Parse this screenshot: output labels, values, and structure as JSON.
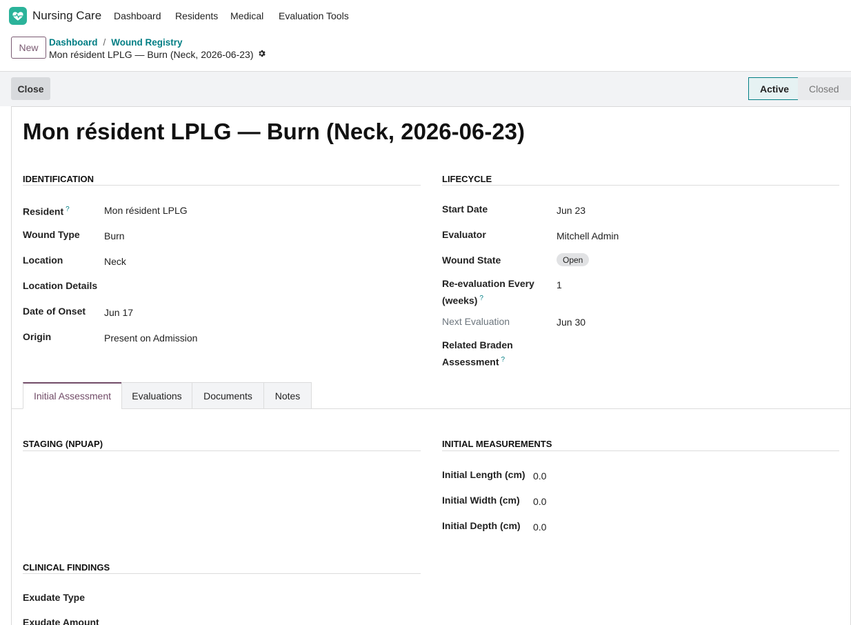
{
  "nav": {
    "app_name": "Nursing Care",
    "menu": [
      "Dashboard",
      "Residents",
      "Medical",
      "Evaluation Tools"
    ]
  },
  "control": {
    "new_label": "New",
    "breadcrumbs": [
      "Dashboard",
      "Wound Registry"
    ],
    "record_title": "Mon résident LPLG — Burn (Neck, 2026-06-23)",
    "close_label": "Close",
    "stages": [
      "Active",
      "Closed"
    ],
    "active_stage": "Active"
  },
  "form": {
    "title": "Mon résident LPLG — Burn (Neck, 2026-06-23)",
    "identification": {
      "title": "Identification",
      "fields": [
        {
          "label": "Resident",
          "value": "Mon résident LPLG",
          "help": "?"
        },
        {
          "label": "Wound Type",
          "value": "Burn"
        },
        {
          "label": "Location",
          "value": "Neck"
        },
        {
          "label": "Location Details",
          "value": ""
        },
        {
          "label": "Date of Onset",
          "value": "Jun 17"
        },
        {
          "label": "Origin",
          "value": "Present on Admission"
        }
      ]
    },
    "lifecycle": {
      "title": "Lifecycle",
      "start_date_label": "Start Date",
      "start_date": "Jun 23",
      "evaluator_label": "Evaluator",
      "evaluator": "Mitchell Admin",
      "wound_state_label": "Wound State",
      "wound_state": "Open",
      "reeval_label_1": "Re-evaluation Every",
      "reeval_label_2": "(weeks)",
      "reeval_value": "1",
      "next_eval_label": "Next Evaluation",
      "next_eval": "Jun 30",
      "braden_label_1": "Related Braden",
      "braden_label_2": "Assessment",
      "help": "?"
    },
    "tabs": [
      "Initial Assessment",
      "Evaluations",
      "Documents",
      "Notes"
    ],
    "active_tab": "Initial Assessment",
    "staging_title": "Staging (NPUAP)",
    "measurements": {
      "title": "Initial Measurements",
      "fields": [
        {
          "label": "Initial Length (cm)",
          "value": "0.0"
        },
        {
          "label": "Initial Width (cm)",
          "value": "0.0"
        },
        {
          "label": "Initial Depth (cm)",
          "value": "0.0"
        }
      ]
    },
    "clinical": {
      "title": "Clinical Findings",
      "fields": [
        "Exudate Type",
        "Exudate Amount"
      ]
    }
  },
  "colors": {
    "brand": "#714b67",
    "link": "#017e84",
    "logo": "#2bb39a"
  }
}
